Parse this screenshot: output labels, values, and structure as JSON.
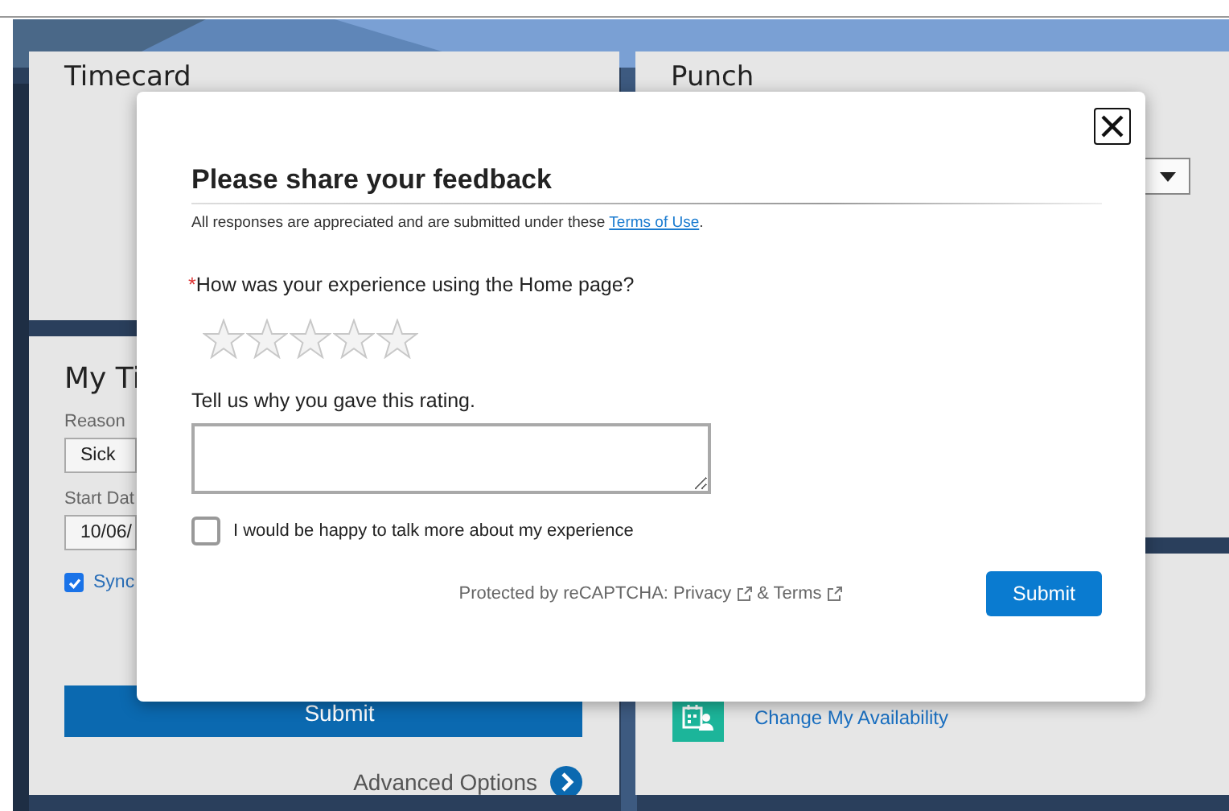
{
  "background": {
    "timecard": {
      "title": "Timecard"
    },
    "punch": {
      "title": "Punch"
    },
    "time_off": {
      "title": "My Ti",
      "reason_label": "Reason",
      "reason_value": "Sick",
      "start_date_label": "Start Dat",
      "start_date_value": "10/06/",
      "sync": {
        "label": "Sync",
        "checked": true
      },
      "submit": "Submit",
      "advanced": "Advanced Options"
    },
    "availability": {
      "link": "Change My Availability"
    }
  },
  "dialog": {
    "title": "Please share your feedback",
    "subtitle": "All responses are appreciated and are submitted under these ",
    "terms_link": "Terms of Use",
    "subtitle_end": ".",
    "question": {
      "required_mark": "*",
      "text": "How was your experience using the Home page?"
    },
    "rating": {
      "stars": 0
    },
    "comment_label": "Tell us why you gave this rating.",
    "contact": {
      "label": "I would be happy to talk more about my experience",
      "checked": false
    },
    "recaptcha": {
      "text": "Protected by reCAPTCHA: Privacy",
      "terms": "& Terms"
    },
    "submit": "Submit"
  }
}
